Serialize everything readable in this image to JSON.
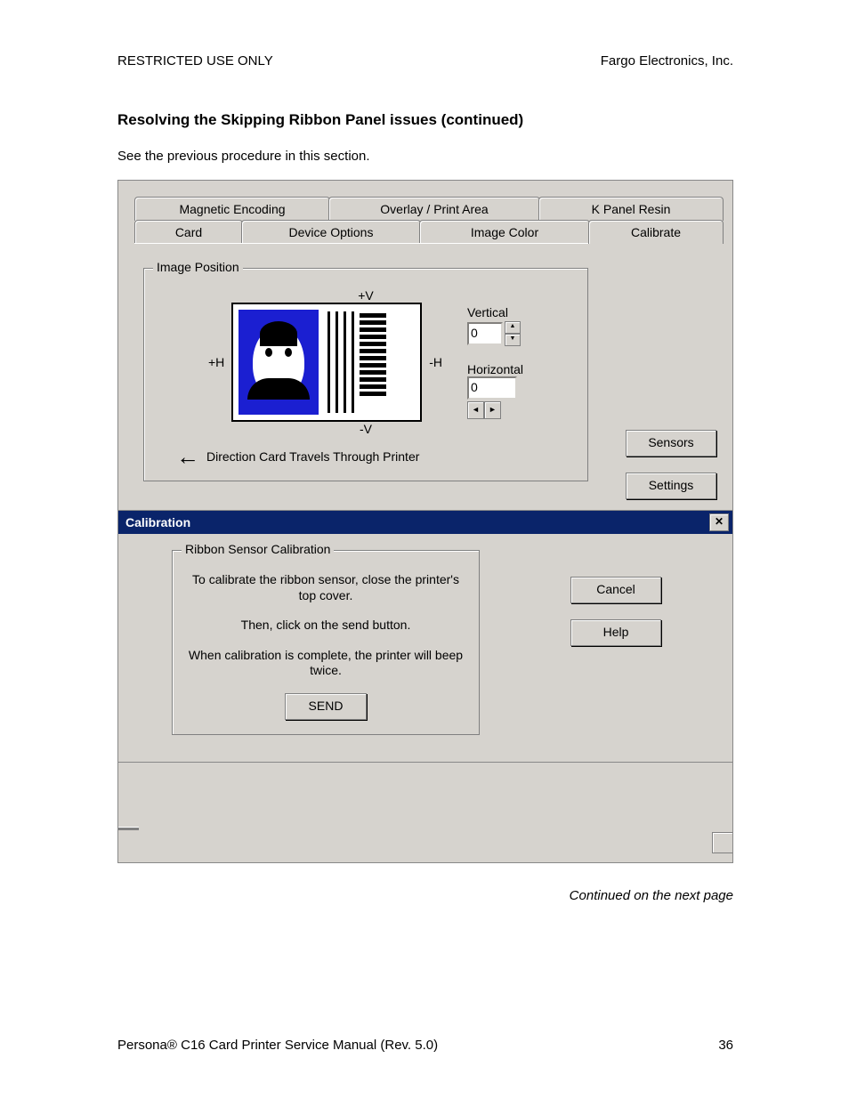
{
  "header": {
    "left": "RESTRICTED USE ONLY",
    "right": "Fargo Electronics, Inc."
  },
  "section_title": "Resolving the Skipping Ribbon Panel issues (continued)",
  "intro_text": "See the previous procedure in this section.",
  "tabs_back": [
    {
      "label": "Magnetic Encoding"
    },
    {
      "label": "Overlay / Print Area"
    },
    {
      "label": "K Panel Resin"
    }
  ],
  "tabs_front": [
    {
      "label": "Card"
    },
    {
      "label": "Device Options"
    },
    {
      "label": "Image Color"
    },
    {
      "label": "Calibrate"
    }
  ],
  "image_position": {
    "legend": "Image Position",
    "plus_v": "+V",
    "minus_v": "-V",
    "plus_h": "+H",
    "minus_h": "-H",
    "vertical_label": "Vertical",
    "vertical_value": "0",
    "horizontal_label": "Horizontal",
    "horizontal_value": "0",
    "direction_text": "Direction Card Travels Through Printer"
  },
  "side_buttons": {
    "sensors": "Sensors",
    "settings": "Settings"
  },
  "dialog": {
    "title": "Calibration",
    "group_legend": "Ribbon Sensor Calibration",
    "line1": "To calibrate the ribbon sensor, close the printer's top cover.",
    "line2": "Then, click on the send button.",
    "line3": "When calibration is complete, the printer will beep twice.",
    "send": "SEND",
    "cancel": "Cancel",
    "help": "Help"
  },
  "continued": "Continued on the next page",
  "footer": {
    "left_prefix": "Persona",
    "left_suffix": " C16 Card Printer Service Manual (Rev. 5.0)",
    "right": "36"
  }
}
